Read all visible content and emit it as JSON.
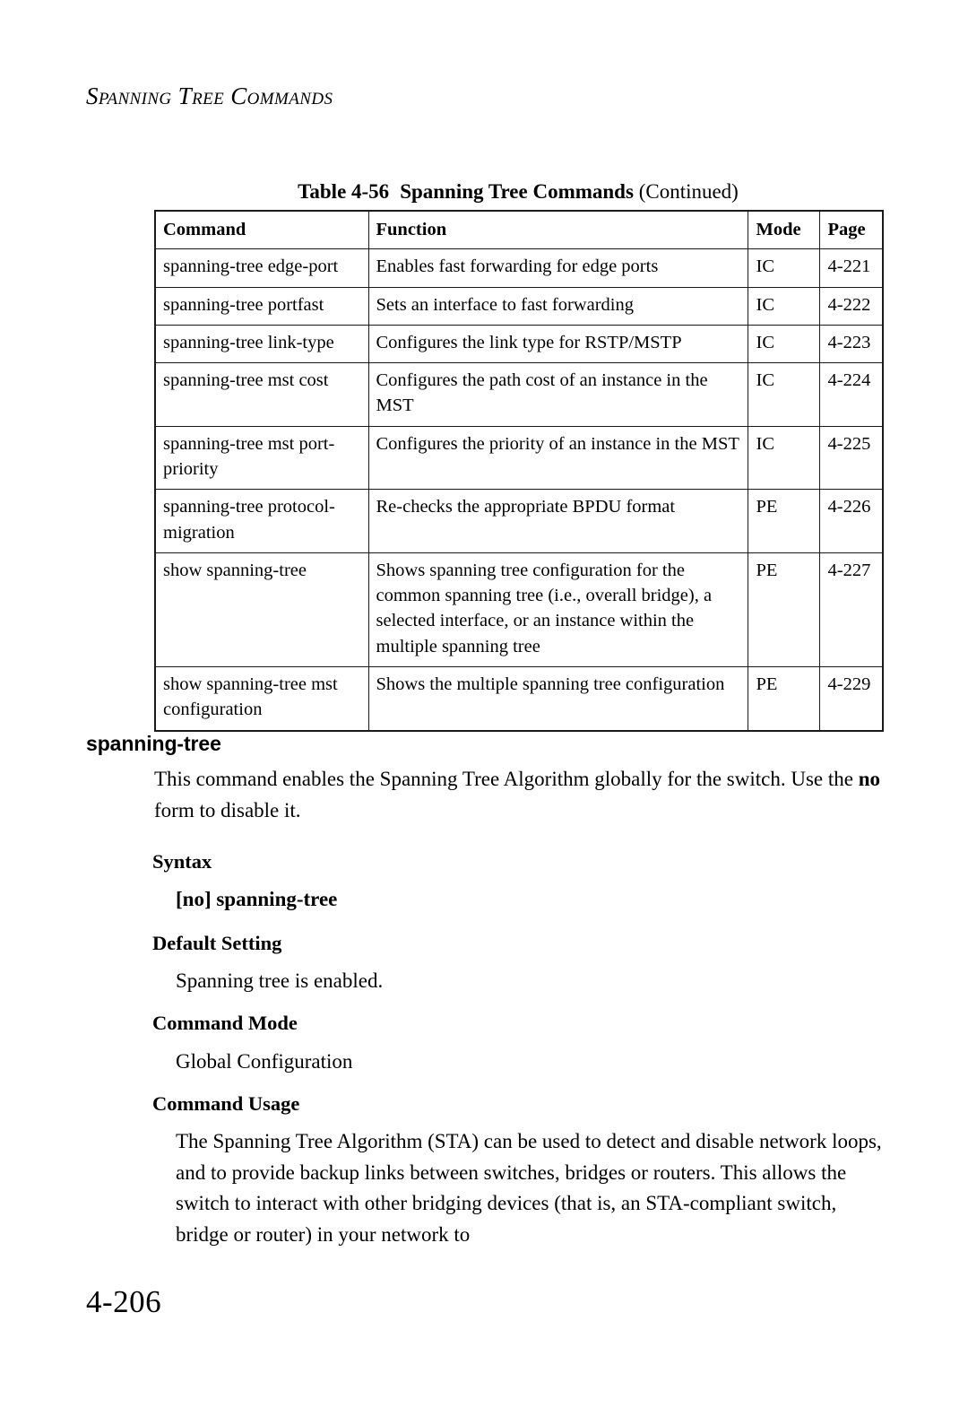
{
  "page": {
    "running_header": "Spanning Tree Commands",
    "folio": "4-206"
  },
  "table": {
    "caption_label": "Table 4-56",
    "caption_title": "Spanning Tree Commands",
    "caption_suffix": "(Continued)",
    "columns": [
      "Command",
      "Function",
      "Mode",
      "Page"
    ],
    "rows": [
      {
        "command": "spanning-tree edge-port",
        "function": "Enables fast forwarding for edge ports",
        "mode": "IC",
        "page": "4-221"
      },
      {
        "command": "spanning-tree portfast",
        "function": "Sets an interface to fast forwarding",
        "mode": "IC",
        "page": "4-222"
      },
      {
        "command": "spanning-tree link-type",
        "function": "Configures the link type for RSTP/MSTP",
        "mode": "IC",
        "page": "4-223"
      },
      {
        "command": "spanning-tree mst cost",
        "function": "Configures the path cost of an instance in the MST",
        "mode": "IC",
        "page": "4-224"
      },
      {
        "command": "spanning-tree mst port-priority",
        "function": "Configures the priority of an instance in the MST",
        "mode": "IC",
        "page": "4-225"
      },
      {
        "command": "spanning-tree protocol-migration",
        "function": "Re-checks the appropriate BPDU format",
        "mode": "PE",
        "page": "4-226"
      },
      {
        "command": "show spanning-tree",
        "function": "Shows spanning tree configuration for the common spanning tree (i.e., overall bridge), a selected interface, or an instance within the multiple spanning tree",
        "mode": "PE",
        "page": "4-227"
      },
      {
        "command": "show spanning-tree mst configuration",
        "function": "Shows the multiple spanning tree configuration",
        "mode": "PE",
        "page": "4-229"
      }
    ]
  },
  "command_section": {
    "heading": "spanning-tree",
    "description_part1": "This command enables the Spanning Tree Algorithm globally for the switch. Use the ",
    "description_bold": "no",
    "description_part2": " form to disable it.",
    "syntax_heading": "Syntax",
    "syntax_line": "[no] spanning-tree",
    "default_setting_heading": "Default Setting",
    "default_setting_text": "Spanning tree is enabled.",
    "command_mode_heading": "Command Mode",
    "command_mode_text": "Global Configuration",
    "command_usage_heading": "Command Usage",
    "command_usage_text": "The Spanning Tree Algorithm (STA) can be used to detect and disable network loops, and to provide backup links between switches, bridges or routers. This allows the switch to interact with other bridging devices (that is, an STA-compliant switch, bridge or router) in your network to"
  }
}
